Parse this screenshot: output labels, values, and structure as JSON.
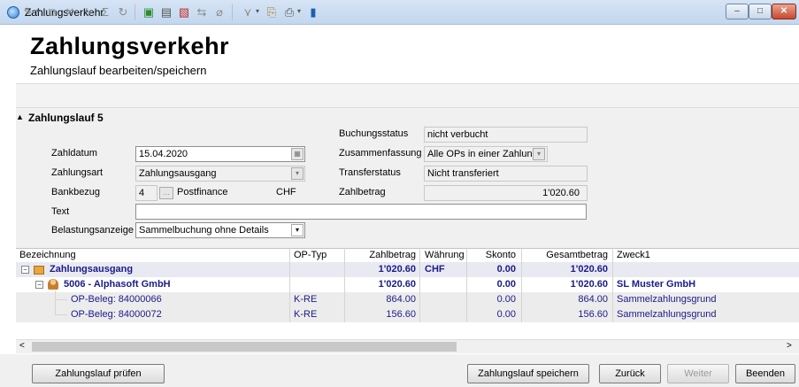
{
  "window": {
    "title": "Zahlungsverkehr"
  },
  "header": {
    "title": "Zahlungsverkehr",
    "subtitle": "Zahlungslauf bearbeiten/speichern"
  },
  "group": {
    "title": "Zahlungslauf 5",
    "zahldatum_label": "Zahldatum",
    "zahldatum_value": "15.04.2020",
    "zahlungsart_label": "Zahlungsart",
    "zahlungsart_value": "Zahlungsausgang",
    "bankbezug_label": "Bankbezug",
    "bankbezug_nr": "4",
    "bankbezug_name": "Postfinance",
    "bankbezug_currency": "CHF",
    "text_label": "Text",
    "text_value": "",
    "belastungsanzeige_label": "Belastungsanzeige",
    "belastungsanzeige_value": "Sammelbuchung ohne Details",
    "buchungsstatus_label": "Buchungsstatus",
    "buchungsstatus_value": "nicht verbucht",
    "zusammenfassung_label": "Zusammenfassung",
    "zusammenfassung_value": "Alle OPs in einer Zahlung",
    "transferstatus_label": "Transferstatus",
    "transferstatus_value": "Nicht transferiert",
    "zahlbetrag_label": "Zahlbetrag",
    "zahlbetrag_value": "1'020.60"
  },
  "grid": {
    "columns": [
      "Bezeichnung",
      "OP-Typ",
      "Zahlbetrag",
      "Währung",
      "Skonto",
      "Gesamtbetrag",
      "Zweck1"
    ],
    "rows": [
      {
        "bezeichnung": "Zahlungsausgang",
        "optyp": "",
        "zahlbetrag": "1'020.60",
        "waehrung": "CHF",
        "skonto": "0.00",
        "gesamt": "1'020.60",
        "zweck": ""
      },
      {
        "bezeichnung": "5006 - Alphasoft GmbH",
        "optyp": "",
        "zahlbetrag": "1'020.60",
        "waehrung": "",
        "skonto": "0.00",
        "gesamt": "1'020.60",
        "zweck": "SL Muster GmbH"
      },
      {
        "bezeichnung": "OP-Beleg: 84000066",
        "optyp": "K-RE",
        "zahlbetrag": "864.00",
        "waehrung": "",
        "skonto": "0.00",
        "gesamt": "864.00",
        "zweck": "Sammelzahlungsgrund"
      },
      {
        "bezeichnung": "OP-Beleg: 84000072",
        "optyp": "K-RE",
        "zahlbetrag": "156.60",
        "waehrung": "",
        "skonto": "0.00",
        "gesamt": "156.60",
        "zweck": "Sammelzahlungsgrund"
      }
    ]
  },
  "footer": {
    "pruefen": "Zahlungslauf prüfen",
    "speichern": "Zahlungslauf speichern",
    "zurueck": "Zurück",
    "weiter": "Weiter",
    "beenden": "Beenden"
  },
  "window_buttons": {
    "minimize": "–",
    "maximize": "□",
    "close": "✕"
  }
}
